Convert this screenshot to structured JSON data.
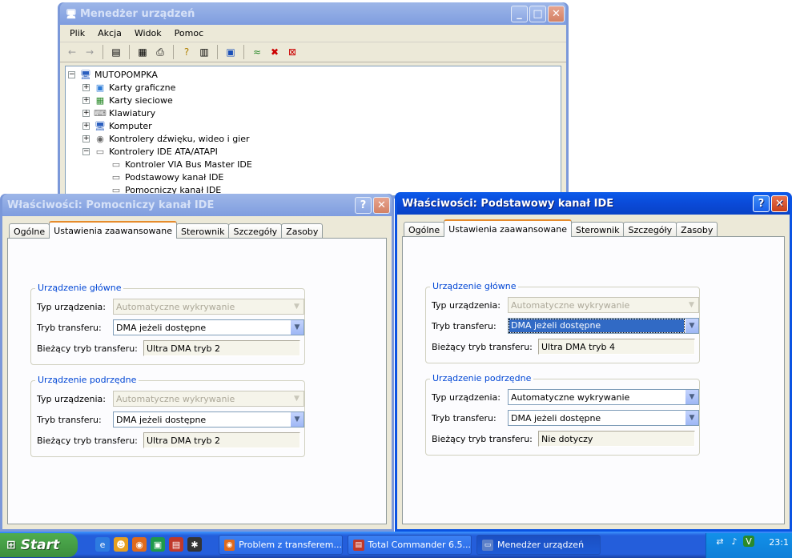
{
  "device_manager": {
    "title": "Menedżer urządzeń",
    "menu": [
      "Plik",
      "Akcja",
      "Widok",
      "Pomoc"
    ],
    "tree": {
      "root": "MUTOPOMPKA",
      "items": [
        "Karty graficzne",
        "Karty sieciowe",
        "Klawiatury",
        "Komputer",
        "Kontrolery dźwięku, wideo i gier",
        "Kontrolery IDE ATA/ATAPI"
      ],
      "children": [
        "Kontroler VIA Bus Master IDE",
        "Podstawowy kanał IDE",
        "Pomocniczy kanał IDE"
      ]
    }
  },
  "dialog_secondary": {
    "title": "Właściwości: Pomocniczy kanał IDE",
    "tabs": [
      "Ogólne",
      "Ustawienia zaawansowane",
      "Sterownik",
      "Szczegóły",
      "Zasoby"
    ],
    "master": {
      "group_title": "Urządzenie główne",
      "device_type_label": "Typ urządzenia:",
      "device_type_value": "Automatyczne wykrywanie",
      "transfer_mode_label": "Tryb transferu:",
      "transfer_mode_value": "DMA jeżeli dostępne",
      "current_mode_label": "Bieżący tryb transferu:",
      "current_mode_value": "Ultra DMA tryb 2"
    },
    "slave": {
      "group_title": "Urządzenie podrzędne",
      "device_type_label": "Typ urządzenia:",
      "device_type_value": "Automatyczne wykrywanie",
      "transfer_mode_label": "Tryb transferu:",
      "transfer_mode_value": "DMA jeżeli dostępne",
      "current_mode_label": "Bieżący tryb transferu:",
      "current_mode_value": "Ultra DMA tryb 2"
    }
  },
  "dialog_primary": {
    "title": "Właściwości: Podstawowy kanał IDE",
    "tabs": [
      "Ogólne",
      "Ustawienia zaawansowane",
      "Sterownik",
      "Szczegóły",
      "Zasoby"
    ],
    "master": {
      "group_title": "Urządzenie główne",
      "device_type_label": "Typ urządzenia:",
      "device_type_value": "Automatyczne wykrywanie",
      "transfer_mode_label": "Tryb transferu:",
      "transfer_mode_value": "DMA jeżeli dostępne",
      "current_mode_label": "Bieżący tryb transferu:",
      "current_mode_value": "Ultra DMA tryb 4"
    },
    "slave": {
      "group_title": "Urządzenie podrzędne",
      "device_type_label": "Typ urządzenia:",
      "device_type_value": "Automatyczne wykrywanie",
      "transfer_mode_label": "Tryb transferu:",
      "transfer_mode_value": "DMA jeżeli dostępne",
      "current_mode_label": "Bieżący tryb transferu:",
      "current_mode_value": "Nie dotyczy"
    }
  },
  "taskbar": {
    "start_label": "Start",
    "tasks": [
      "Problem z transferem...",
      "Total Commander 6.5...",
      "Menedżer urządzeń"
    ],
    "clock": "23:1"
  },
  "colors": {
    "title_active": "#0a53e3",
    "title_inactive": "#7b98d9",
    "dialog_bg": "#ece9d8",
    "group_title": "#0046d5",
    "taskbar": "#245edb",
    "start": "#3c8f3c"
  }
}
